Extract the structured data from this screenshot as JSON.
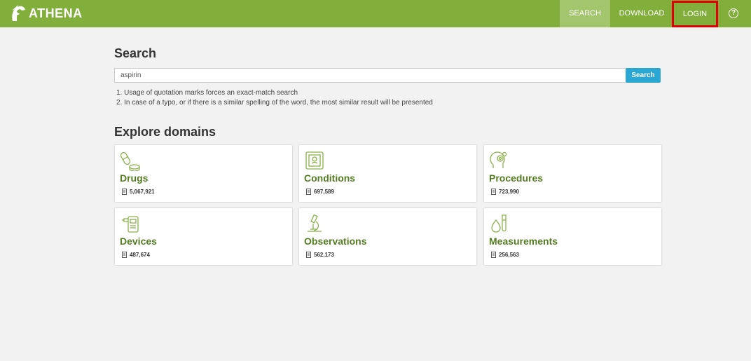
{
  "app": {
    "logo_text": "ATHENA",
    "accent_color": "#82ae3b",
    "active_tab_color": "#a3c56c",
    "highlight_color": "#e00000"
  },
  "nav": {
    "search": "SEARCH",
    "download": "DOWNLOAD",
    "login": "LOGIN",
    "help_icon": "question-circle-icon"
  },
  "search": {
    "heading": "Search",
    "input_value": "aspirin",
    "button_label": "Search",
    "button_color": "#2aa7d3",
    "hints": [
      "1. Usage of quotation marks forces an exact-match search",
      "2. In case of a typo, or if there is a similar spelling of the word, the most similar result will be presented"
    ]
  },
  "explore": {
    "heading": "Explore domains",
    "domains": [
      {
        "title": "Drugs",
        "count": "5,067,921",
        "icon": "pill-icon"
      },
      {
        "title": "Conditions",
        "count": "697,589",
        "icon": "x-ray-icon"
      },
      {
        "title": "Procedures",
        "count": "723,990",
        "icon": "head-gear-icon"
      },
      {
        "title": "Devices",
        "count": "487,674",
        "icon": "medical-device-icon"
      },
      {
        "title": "Observations",
        "count": "562,173",
        "icon": "microscope-icon"
      },
      {
        "title": "Measurements",
        "count": "256,563",
        "icon": "test-tube-icon"
      }
    ]
  }
}
